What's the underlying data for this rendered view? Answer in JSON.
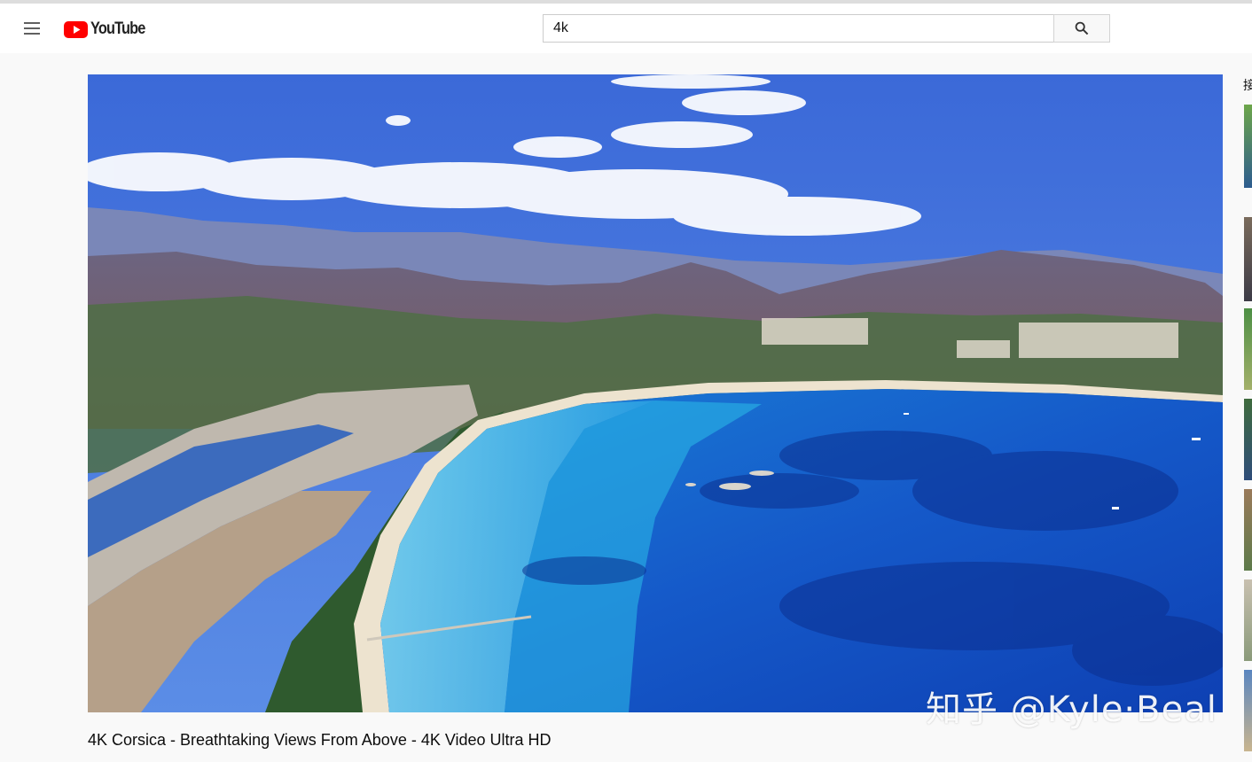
{
  "header": {
    "logo_text": "YouTube",
    "menu_icon": "hamburger-menu-icon",
    "search": {
      "value": "4k",
      "button_icon": "search-icon"
    }
  },
  "player": {
    "watermark": "知乎 @Kyle·Beal"
  },
  "video": {
    "title": "4K Corsica - Breathtaking Views From Above - 4K Video Ultra HD"
  },
  "sidebar": {
    "heading_partial": "接"
  },
  "colors": {
    "brand_red": "#ff0000",
    "header_bg": "#ffffff",
    "page_bg": "#f9f9f9"
  }
}
